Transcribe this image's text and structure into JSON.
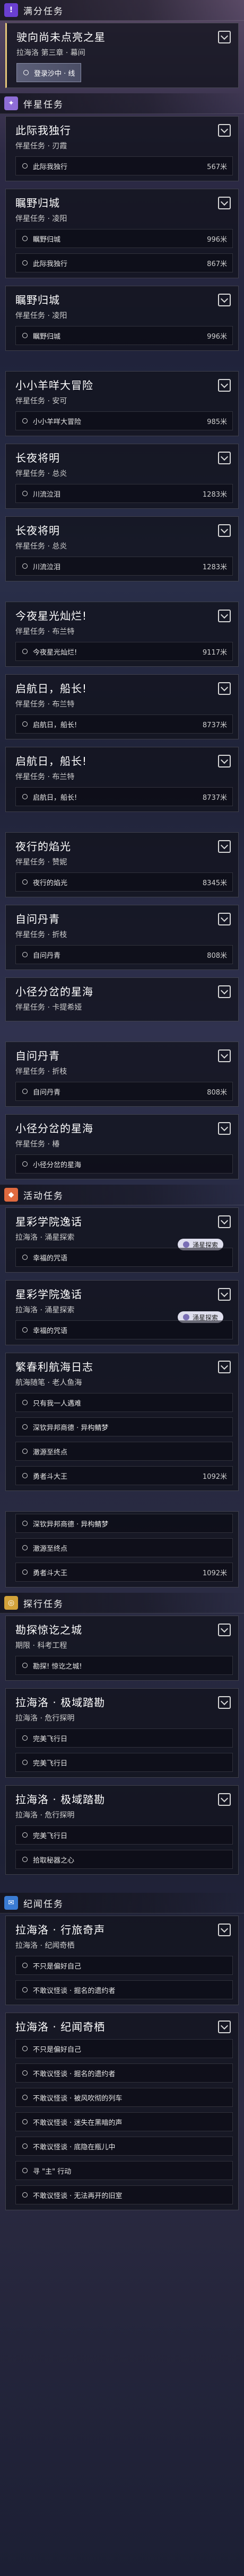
{
  "colors": {
    "trial": "#6a3fd1",
    "companion": "#8e6dd6",
    "event": "#e06a3f",
    "exploration": "#d2a23a",
    "daily": "#3a7bd2",
    "accent": "#e6c77a"
  },
  "icons": {
    "section_badge": "quest-badge-icon",
    "right": "quest-expand-icon",
    "objective": "objective-circle-icon",
    "floater": "npc-marker-icon",
    "diamond": "map-marker-icon"
  },
  "sections": [
    {
      "title": "满分任务",
      "badge": "!",
      "color": "#6a3fd1",
      "quests": [
        {
          "title": "驶向尚未点亮之星",
          "sub": "拉海洛 第三章 · 幕间",
          "active": true,
          "objectives": [
            {
              "text": "登录沙中 · 线",
              "dist": "",
              "track": true
            }
          ]
        }
      ]
    },
    {
      "title": "伴星任务",
      "badge": "✦",
      "color": "#8e6dd6",
      "quests": [
        {
          "title": "此际我独行",
          "sub": "伴星任务 · 刃霞",
          "objectives": [
            {
              "text": "此际我独行",
              "dist": "567米"
            }
          ]
        },
        {
          "title": "瞩野归城",
          "sub": "伴星任务 · 凌阳",
          "objectives": [
            {
              "text": "瞩野归城",
              "dist": "996米"
            },
            {
              "text": "此际我独行",
              "dist": "867米"
            }
          ]
        },
        {
          "title": "瞩野归城",
          "sub": "伴星任务 · 凌阳",
          "objectives": [
            {
              "text": "瞩野归城",
              "dist": "996米"
            }
          ]
        },
        {
          "title": "小小羊咩大冒险",
          "sub": "伴星任务 · 安可",
          "objectives": [
            {
              "text": "小小羊咩大冒险",
              "dist": "985米"
            }
          ]
        },
        {
          "title": "长夜将明",
          "sub": "伴星任务 · 总炎",
          "objectives": [
            {
              "text": "川流泣泪",
              "dist": "1283米"
            }
          ]
        },
        {
          "title": "长夜将明",
          "sub": "伴星任务 · 总炎",
          "objectives": [
            {
              "text": "川流泣泪",
              "dist": "1283米"
            }
          ]
        },
        {
          "title": "今夜星光灿烂!",
          "sub": "伴星任务 · 布兰特",
          "objectives": [
            {
              "text": "今夜星光灿烂!",
              "dist": "9117米"
            }
          ]
        },
        {
          "title": "启航日，船长!",
          "sub": "伴星任务 · 布兰特",
          "objectives": [
            {
              "text": "启航日，船长!",
              "dist": "8737米"
            }
          ]
        },
        {
          "title": "启航日，船长!",
          "sub": "伴星任务 · 布兰特",
          "objectives": [
            {
              "text": "启航日，船长!",
              "dist": "8737米"
            }
          ]
        },
        {
          "title": "夜行的焰光",
          "sub": "伴星任务 · 赞妮",
          "objectives": [
            {
              "text": "夜行的焰光",
              "dist": "8345米"
            }
          ]
        },
        {
          "title": "自问丹青",
          "sub": "伴星任务 · 折枝",
          "objectives": [
            {
              "text": "自问丹青",
              "dist": "808米"
            }
          ]
        },
        {
          "title": "小径分岔的星海",
          "sub": "伴星任务 · 卡提希娅",
          "objectives": []
        },
        {
          "title": "自问丹青",
          "sub": "伴星任务 · 折枝",
          "objectives": [
            {
              "text": "自问丹青",
              "dist": "808米"
            }
          ]
        },
        {
          "title": "小径分岔的星海",
          "sub": "伴星任务 · 椿",
          "objectives": [
            {
              "text": "小径分岔的星海",
              "dist": ""
            }
          ]
        }
      ]
    },
    {
      "title": "活动任务",
      "badge": "◆",
      "color": "#e06a3f",
      "quests": [
        {
          "title": "星彩学院逸话",
          "sub": "拉海洛 · 涌星探索",
          "floater": "涌星探索",
          "objectives": [
            {
              "text": "幸福的咒语",
              "dist": ""
            }
          ]
        },
        {
          "title": "星彩学院逸话",
          "sub": "拉海洛 · 涌星探索",
          "floater": "涌星探索",
          "objectives": [
            {
              "text": "幸福的咒语",
              "dist": ""
            }
          ]
        },
        {
          "title": "繁春利航海日志",
          "sub": "航海随笔 · 老人鱼海",
          "objectives": [
            {
              "text": "只有我一人遇难",
              "dist": ""
            },
            {
              "text": "深钦异邦商德 · 异构鲭梦",
              "dist": ""
            },
            {
              "text": "澈源至终点",
              "dist": ""
            },
            {
              "text": "勇者斗大王",
              "dist": "1092米"
            }
          ]
        },
        {
          "title": "",
          "sub": "",
          "objectives": [
            {
              "text": "深钦异邦商德 · 异构鲭梦",
              "dist": ""
            },
            {
              "text": "澈源至终点",
              "dist": ""
            },
            {
              "text": "勇者斗大王",
              "dist": "1092米"
            }
          ]
        }
      ]
    },
    {
      "title": "探行任务",
      "badge": "◎",
      "color": "#d2a23a",
      "quests": [
        {
          "title": "勘探惊讫之城",
          "sub": "期限 · 科考工程",
          "objectives": [
            {
              "text": "勘探! 惊讫之城!",
              "dist": ""
            }
          ]
        },
        {
          "title": "拉海洛 · 极域踏勘",
          "sub": "拉海洛 · 危行探明",
          "objectives": [
            {
              "text": "完美飞行日",
              "dist": ""
            },
            {
              "text": "完美飞行日",
              "dist": ""
            }
          ]
        },
        {
          "title": "拉海洛 · 极域踏勘",
          "sub": "拉海洛 · 危行探明",
          "objectives": [
            {
              "text": "完美飞行日",
              "dist": ""
            },
            {
              "text": "拾取秘器之心",
              "dist": ""
            }
          ]
        }
      ]
    },
    {
      "title": "纪闻任务",
      "badge": "✉",
      "color": "#3a7bd2",
      "quests": [
        {
          "title": "拉海洛 · 行旅奇声",
          "sub": "拉海洛 · 纪闻奇栖",
          "objectives": [
            {
              "text": "不只是偏好自己",
              "dist": ""
            },
            {
              "text": "不敢议怪谈 · 掘名的遗约者",
              "dist": ""
            }
          ]
        },
        {
          "title": "拉海洛 · 纪闻奇栖",
          "sub": "",
          "objectives": [
            {
              "text": "不只是偏好自己",
              "dist": ""
            },
            {
              "text": "不敢议怪谈 · 掘名的遗约者",
              "dist": ""
            },
            {
              "text": "不敢议怪谈 · 被风吹彻的列车",
              "dist": ""
            },
            {
              "text": "不敢议怪谈 · 迷失在黑暗的声",
              "dist": ""
            },
            {
              "text": "不敢议怪谈 · 底隐在瓶儿中",
              "dist": ""
            },
            {
              "text": "寻 \"主\" 行动",
              "dist": ""
            },
            {
              "text": "不敢议怪谈 · 无法再开的旧室",
              "dist": ""
            }
          ]
        }
      ]
    }
  ]
}
